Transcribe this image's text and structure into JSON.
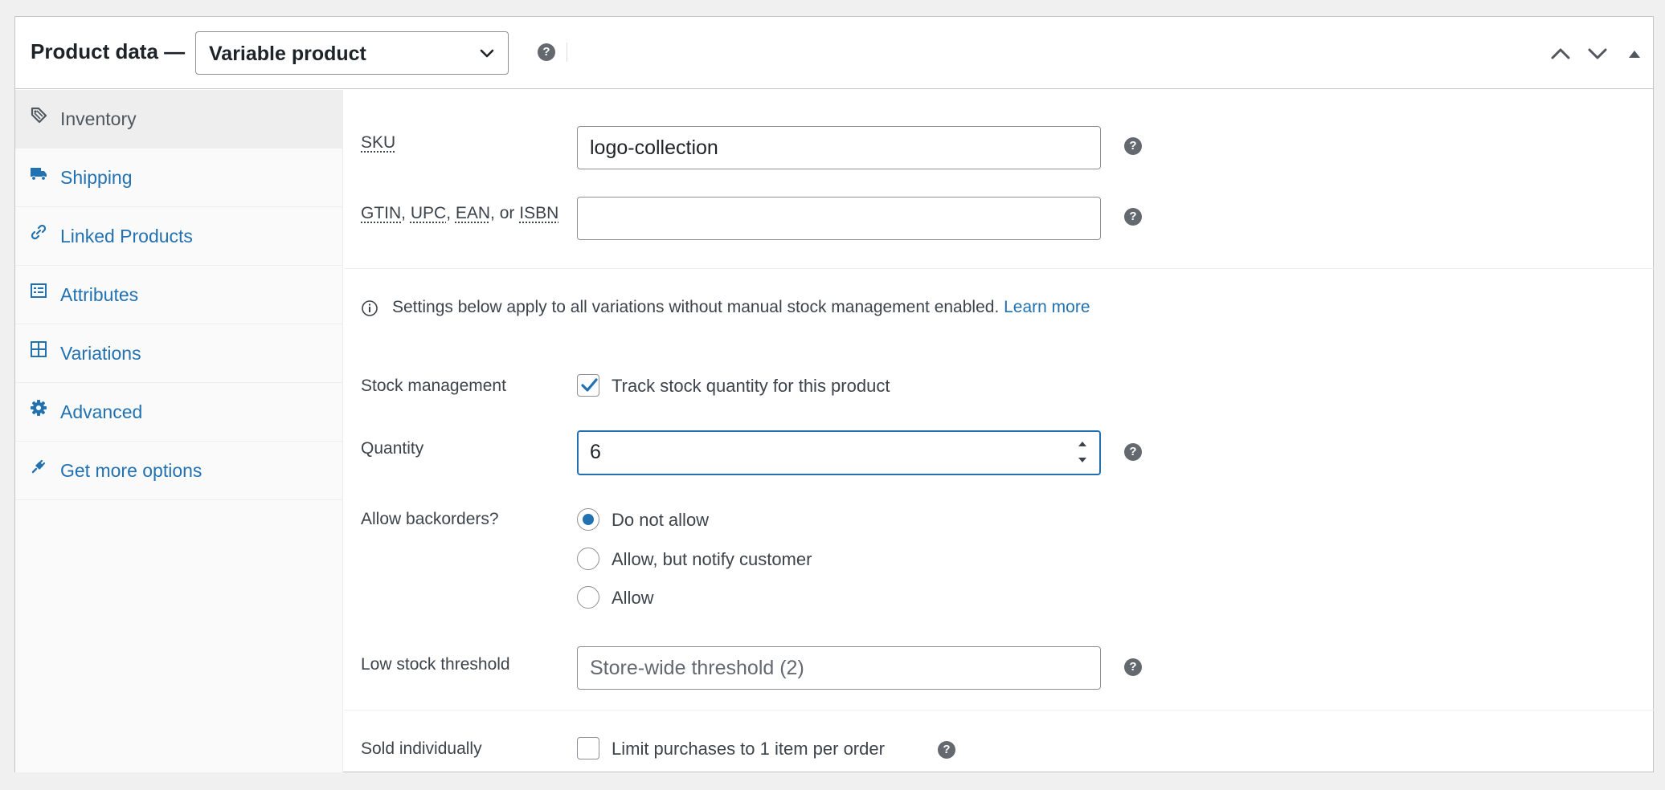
{
  "header": {
    "title": "Product data —",
    "product_type": "Variable product"
  },
  "sidebar": {
    "items": [
      {
        "label": "Inventory",
        "icon": "tag-icon"
      },
      {
        "label": "Shipping",
        "icon": "truck-icon"
      },
      {
        "label": "Linked Products",
        "icon": "link-icon"
      },
      {
        "label": "Attributes",
        "icon": "list-icon"
      },
      {
        "label": "Variations",
        "icon": "grid-icon"
      },
      {
        "label": "Advanced",
        "icon": "gear-icon"
      },
      {
        "label": "Get more options",
        "icon": "plugin-icon"
      }
    ]
  },
  "inventory": {
    "sku_label": "SKU",
    "sku_value": "logo-collection",
    "gtin_label_parts": [
      "GTIN",
      ", ",
      "UPC",
      ", ",
      "EAN",
      ", or ",
      "ISBN"
    ],
    "gtin_value": "",
    "notice_text": "Settings below apply to all variations without manual stock management enabled.",
    "notice_link": "Learn more",
    "stock_management_label": "Stock management",
    "track_stock_label": "Track stock quantity for this product",
    "quantity_label": "Quantity",
    "quantity_value": "6",
    "backorders_label": "Allow backorders?",
    "backorder_options": [
      "Do not allow",
      "Allow, but notify customer",
      "Allow"
    ],
    "backorder_selected": "Do not allow",
    "low_stock_label": "Low stock threshold",
    "low_stock_placeholder": "Store-wide threshold (2)",
    "sold_individually_label": "Sold individually",
    "limit_purchases_label": "Limit purchases to 1 item per order"
  },
  "colors": {
    "accent": "#2271b1",
    "text": "#1d2327",
    "muted": "#646970"
  }
}
